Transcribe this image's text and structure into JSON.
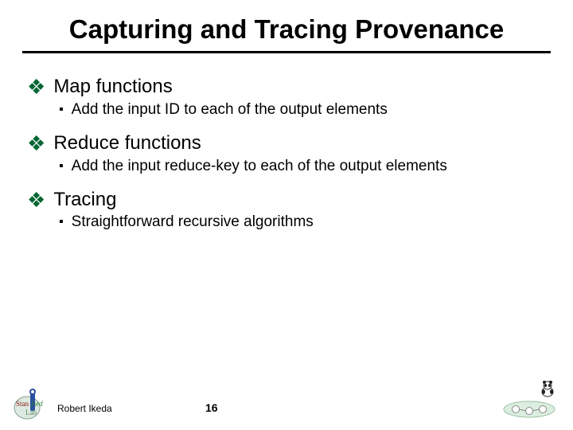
{
  "title": "Capturing and Tracing Provenance",
  "sections": [
    {
      "heading": "Map functions",
      "items": [
        "Add the input ID to each of the output elements"
      ]
    },
    {
      "heading": "Reduce functions",
      "items": [
        "Add the input reduce-key to each of the output elements"
      ]
    },
    {
      "heading": "Tracing",
      "items": [
        "Straightforward recursive algorithms"
      ]
    }
  ],
  "footer": {
    "author": "Robert Ikeda",
    "page_number": "16",
    "logo_left_name": "stanford-infolab-logo",
    "logo_right_name": "panda-diagram-logo"
  },
  "colors": {
    "bullet_l1": "#006633"
  }
}
